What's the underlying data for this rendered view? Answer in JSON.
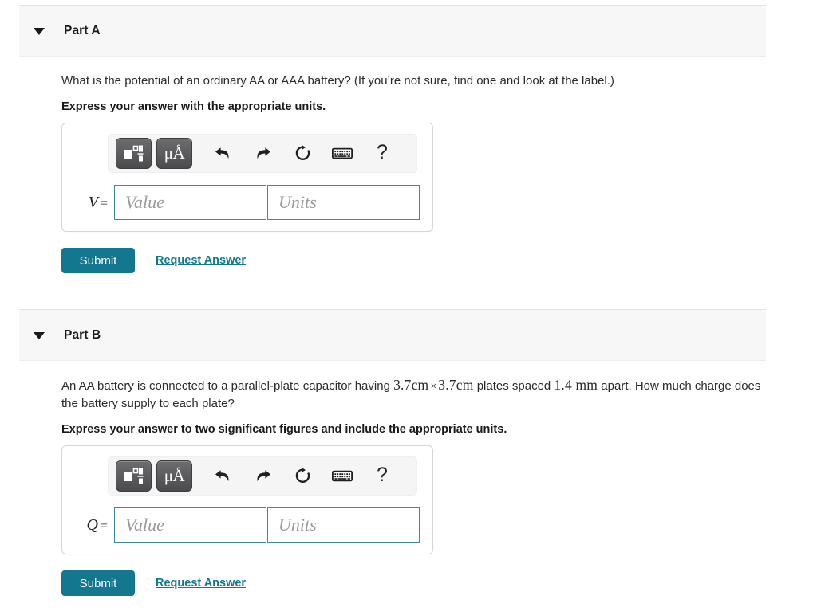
{
  "colors": {
    "accent": "#12778f",
    "field_border": "#3d8a9c",
    "header_bg": "#f7f7f8",
    "toolbar_bg": "#f5f5f6",
    "tool_button": "#4b4b4e"
  },
  "parts": [
    {
      "id": "part-a",
      "title": "Part A",
      "question_prefix": "What is the potential of an ordinary AA or AAA battery? (If you’re not sure, find one and look at the label.)",
      "question_math_1": "",
      "question_mid": "",
      "question_math_2": "",
      "question_suffix": "",
      "instruction": "Express your answer with the appropriate units.",
      "variable": "V",
      "equals": "=",
      "value_placeholder": "Value",
      "units_placeholder": "Units",
      "value_current": "",
      "units_current": "",
      "submit_label": "Submit",
      "request_label": "Request Answer",
      "toolbar": {
        "template_icon": "math-template-icon",
        "units_icon": "micro-angstrom-icon",
        "units_label": "μÅ",
        "undo_icon": "undo-icon",
        "redo_icon": "redo-icon",
        "reset_icon": "reset-icon",
        "keyboard_icon": "keyboard-icon",
        "help_icon": "help-icon",
        "help_label": "?"
      }
    },
    {
      "id": "part-b",
      "title": "Part B",
      "question_prefix": "An AA battery is connected to a parallel-plate capacitor having ",
      "question_math_1": "3.7cm",
      "question_mid": "×",
      "question_math_2": "3.7cm",
      "question_suffix": " plates spaced ",
      "question_math_3": "1.4 mm",
      "question_tail": " apart. How much charge does the battery supply to each plate?",
      "instruction": "Express your answer to two significant figures and include the appropriate units.",
      "variable": "Q",
      "equals": "=",
      "value_placeholder": "Value",
      "units_placeholder": "Units",
      "value_current": "",
      "units_current": "",
      "submit_label": "Submit",
      "request_label": "Request Answer",
      "toolbar": {
        "template_icon": "math-template-icon",
        "units_icon": "micro-angstrom-icon",
        "units_label": "μÅ",
        "undo_icon": "undo-icon",
        "redo_icon": "redo-icon",
        "reset_icon": "reset-icon",
        "keyboard_icon": "keyboard-icon",
        "help_icon": "help-icon",
        "help_label": "?"
      }
    }
  ]
}
